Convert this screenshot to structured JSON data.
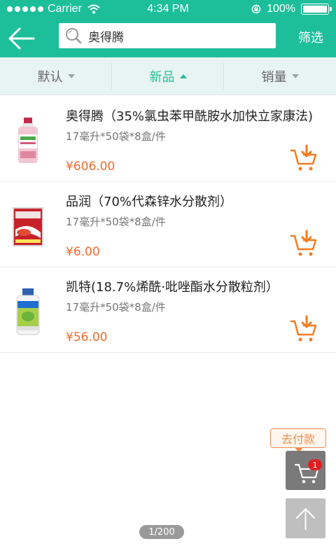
{
  "status_bar": {
    "carrier": "Carrier",
    "time": "4:34 PM",
    "battery": "100%"
  },
  "nav": {
    "search_value": "奥得腾",
    "filter_label": "筛选"
  },
  "sort_tabs": [
    {
      "label": "默认",
      "active": false
    },
    {
      "label": "新品",
      "active": true
    },
    {
      "label": "销量",
      "active": false
    }
  ],
  "products": [
    {
      "name": "奥得腾（35%氯虫苯甲酰胺水加快立家康法)",
      "spec": "17毫升*50袋*8盒/件",
      "price": "¥606.00"
    },
    {
      "name": "品润（70%代森锌水分散剂）",
      "spec": "17毫升*50袋*8盒/件",
      "price": "¥6.00"
    },
    {
      "name": "凯特(18.7%烯酰·吡唑酯水分散粒剂）",
      "spec": "17毫升*50袋*8盒/件",
      "price": "¥56.00"
    }
  ],
  "floating": {
    "pay_label": "去付款",
    "cart_count": "1"
  },
  "pager": {
    "text": "1/200"
  },
  "colors": {
    "primary": "#1dbf9b",
    "price": "#f26a2a",
    "cart_icon": "#f47b20"
  },
  "icons": {
    "back": "back-arrow-icon",
    "search": "search-icon",
    "cart": "add-to-cart-icon",
    "top": "scroll-top-icon"
  }
}
